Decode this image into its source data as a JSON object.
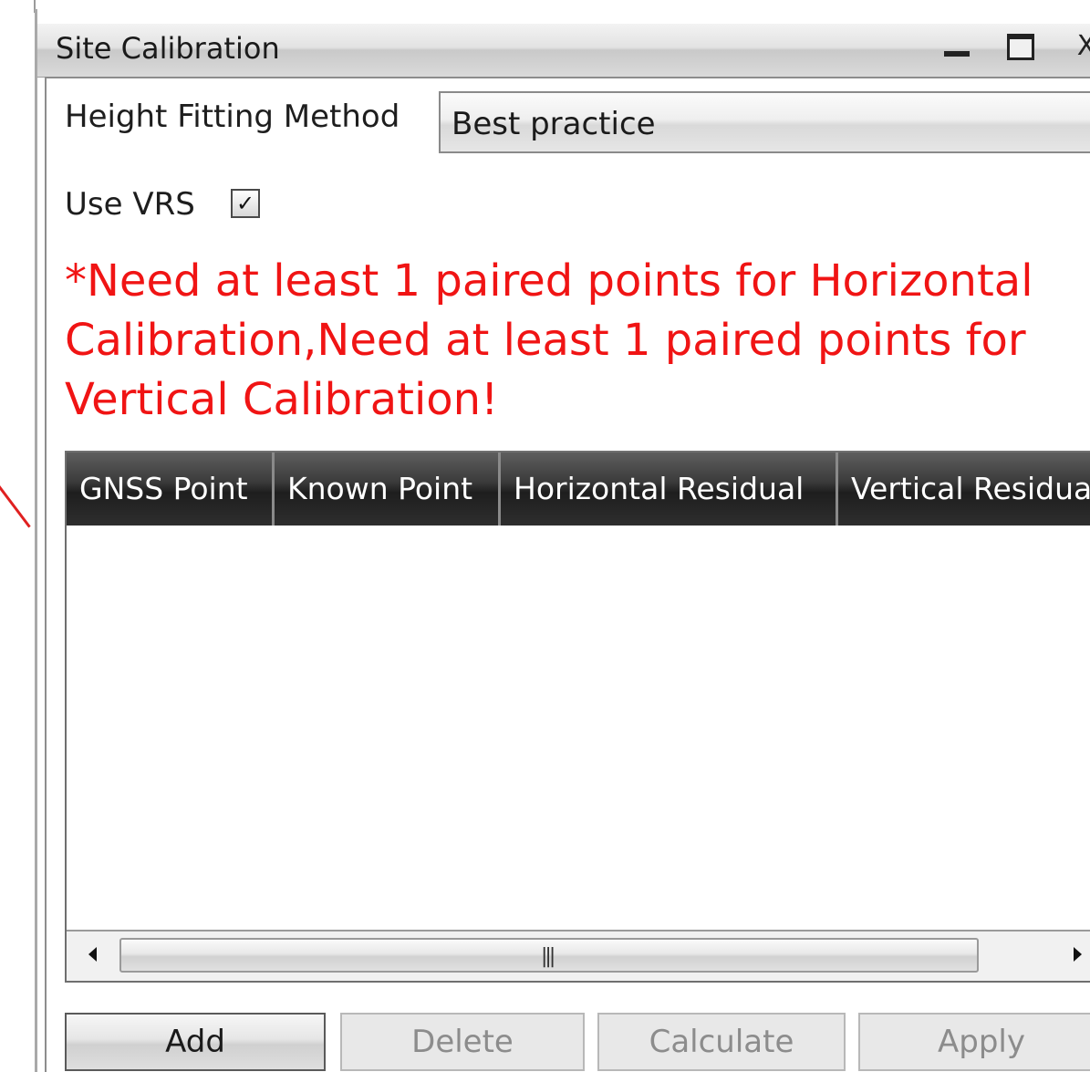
{
  "window": {
    "title": "Site Calibration",
    "minimize_glyph": "_",
    "maximize_glyph": "□",
    "close_glyph": "X"
  },
  "height_fitting": {
    "label": "Height Fitting Method",
    "value": "Best practice"
  },
  "vrs": {
    "label": "Use VRS",
    "checked": true,
    "check_glyph": "✓"
  },
  "warning": {
    "text": "*Need at least 1 paired points for Horizontal Calibration,Need at least 1 paired points for Vertical Calibration!",
    "color": "#f01414"
  },
  "table": {
    "columns": [
      "GNSS Point",
      "Known Point",
      "Horizontal Residual",
      "Vertical Residual"
    ],
    "rows": [],
    "scroll_grip": "|||"
  },
  "buttons": {
    "add": "Add",
    "delete": "Delete",
    "calculate": "Calculate",
    "apply": "Apply"
  }
}
